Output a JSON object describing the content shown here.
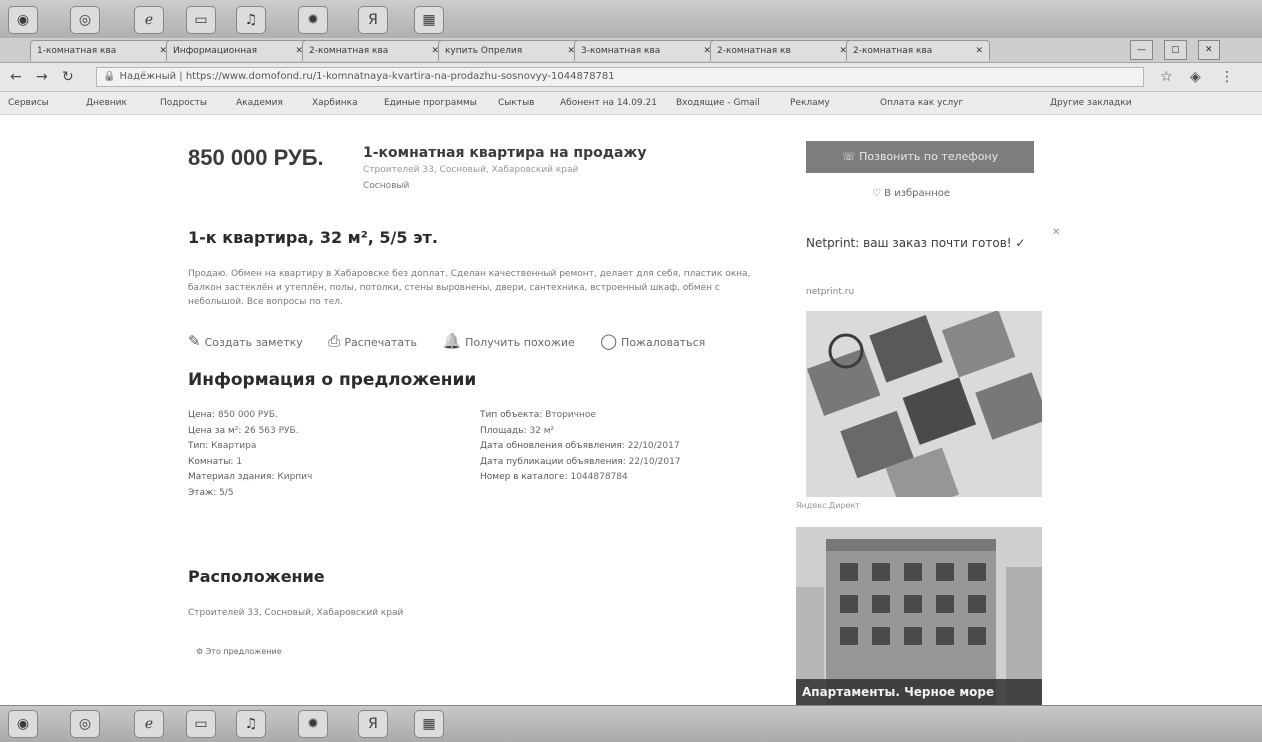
{
  "browser": {
    "tabs": [
      {
        "label": "1-комнатная ква"
      },
      {
        "label": "Информационная"
      },
      {
        "label": "2-комнатная ква"
      },
      {
        "label": "купить Опрелия"
      },
      {
        "label": "3-комнатная ква"
      },
      {
        "label": "2-комнатная кв"
      },
      {
        "label": "2-комнатная ква"
      }
    ],
    "url_label": "Надёжный",
    "url": "https://www.domofond.ru/1-komnatnaya-kvartira-na-prodazhu-sosnovyy-1044878781",
    "bookmarks": [
      "Сервисы",
      "Дневник",
      "Подросты",
      "Академия",
      "Харбинка",
      "Единые программы",
      "Сыктыв",
      "Абонент на 14.09.21",
      "Входящие - Gmail",
      "Рекламу",
      "Оплата как услуг",
      "Другие закладки"
    ]
  },
  "listing": {
    "price": "850 000 РУБ.",
    "title": "1-комнатная квартира на продажу",
    "address": "Строителей 33, Сосновый, Хабаровский край",
    "city": "Сосновый",
    "heading": "1-к квартира, 32 м², 5/5 эт.",
    "description": "Продаю. Обмен на квартиру в Хабаровске без доплат. Сделан качественный ремонт, делает для себя, пластик окна, балкон застеклён и утеплён, полы, потолки, стены выровнены, двери, сантехника, встроенный шкаф, обмен с небольшой. Все вопросы по тел.",
    "actions": [
      {
        "icon": "note-icon",
        "label": "Создать заметку"
      },
      {
        "icon": "print-icon",
        "label": "Распечатать"
      },
      {
        "icon": "bell-icon",
        "label": "Получить похожие"
      },
      {
        "icon": "chat-icon",
        "label": "Пожаловаться"
      }
    ],
    "info_heading": "Информация о предложении",
    "info_left": [
      {
        "k": "Цена:",
        "v": "850 000 РУБ."
      },
      {
        "k": "Цена за м²:",
        "v": "26 563 РУБ."
      },
      {
        "k": "Тип:",
        "v": "Квартира"
      },
      {
        "k": "Комнаты:",
        "v": "1"
      },
      {
        "k": "Материал здания:",
        "v": "Кирпич"
      },
      {
        "k": "Этаж:",
        "v": "5/5"
      }
    ],
    "info_right": [
      {
        "k": "Тип объекта:",
        "v": "Вторичное"
      },
      {
        "k": "Площадь:",
        "v": "32 м²"
      },
      {
        "k": "Дата обновления объявления:",
        "v": "22/10/2017"
      },
      {
        "k": "Дата публикации объявления:",
        "v": "22/10/2017"
      },
      {
        "k": "Номер в каталоге:",
        "v": "1044878784"
      }
    ],
    "location_heading": "Расположение",
    "location_address": "Строителей 33, Сосновый, Хабаровский край",
    "similar": "Это предложение"
  },
  "sidebar": {
    "contact_button": "Позвонить по телефону",
    "favorite": "В избранное",
    "ad_title": "Netprint: ваш заказ почти готов! ✓",
    "ad_domain": "netprint.ru",
    "ad_caption": "Яндекс.Директ",
    "ad2_caption": "Апартаменты. Черное море"
  }
}
